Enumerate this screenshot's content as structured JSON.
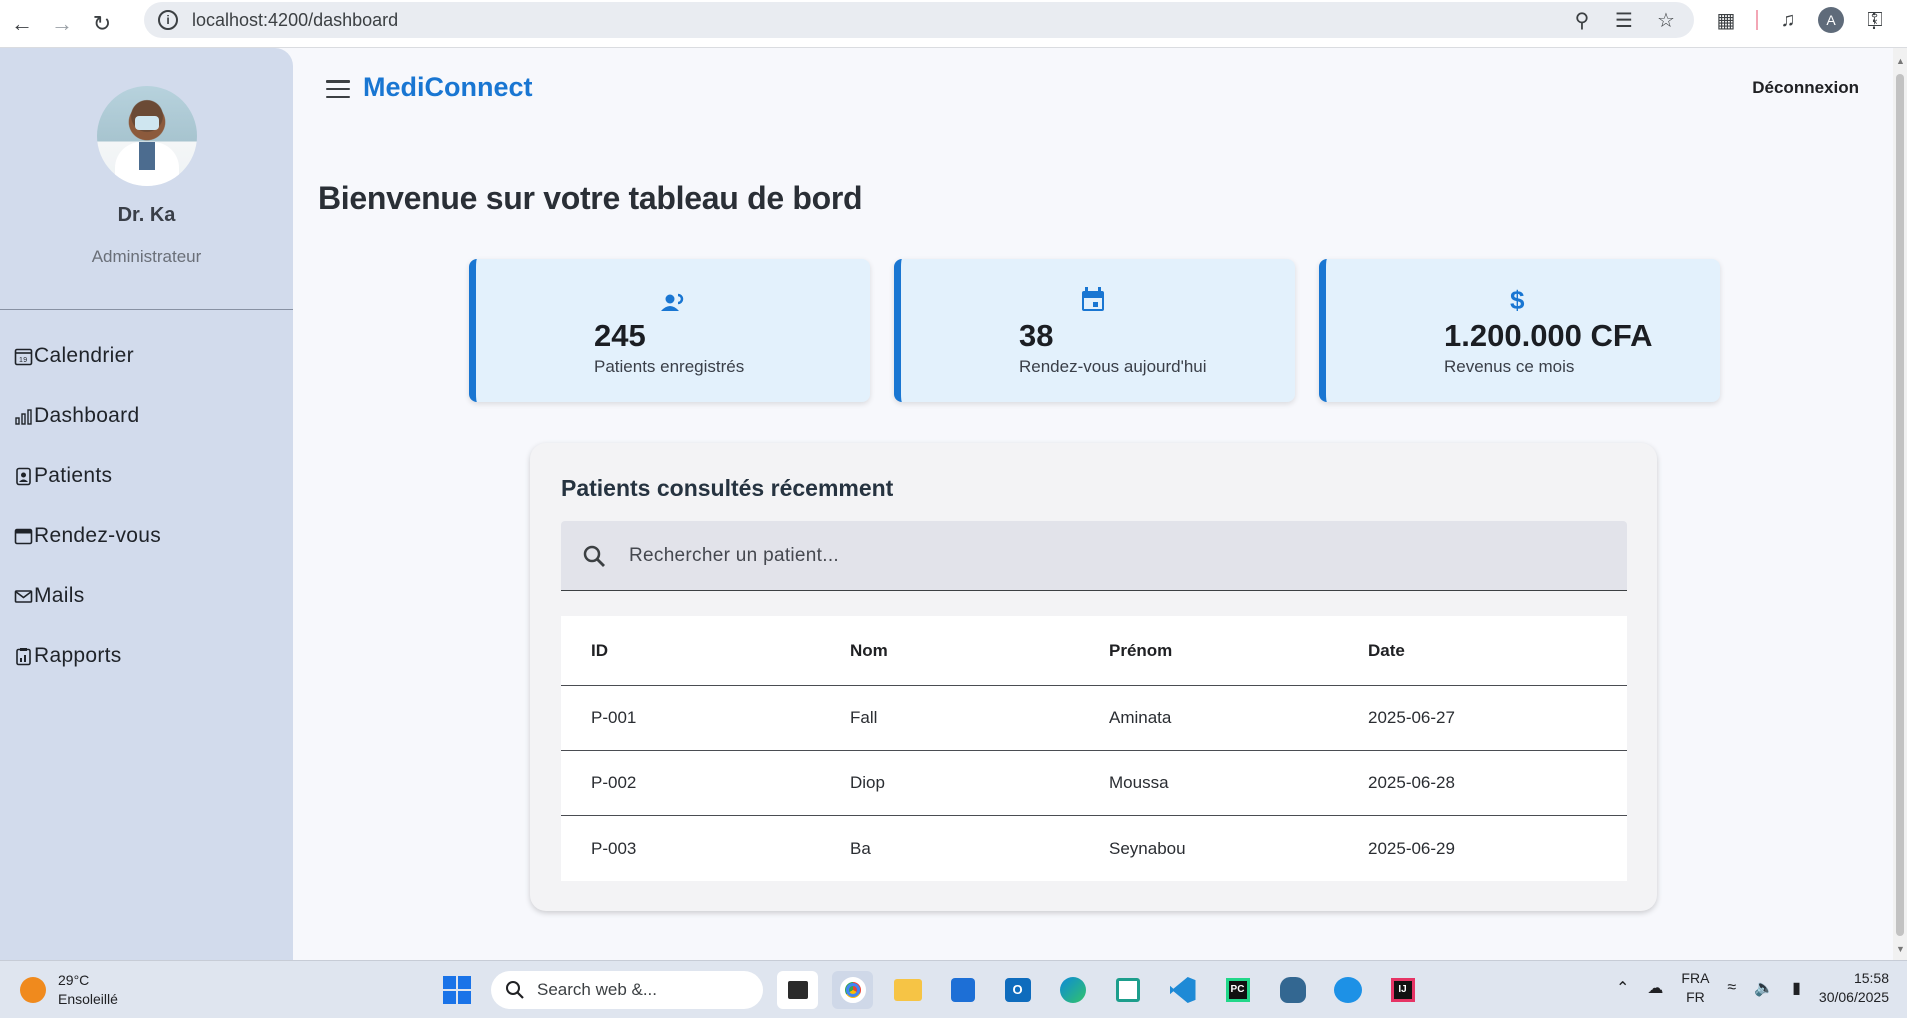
{
  "browser": {
    "url": "localhost:4200/dashboard",
    "profile_initial": "A"
  },
  "sidebar": {
    "user_name": "Dr. Ka",
    "user_role": "Administrateur",
    "items": [
      {
        "label": "Calendrier",
        "icon": "calendar-icon"
      },
      {
        "label": "Dashboard",
        "icon": "bar-chart-icon"
      },
      {
        "label": "Patients",
        "icon": "patient-card-icon"
      },
      {
        "label": "Rendez-vous",
        "icon": "calendar-window-icon"
      },
      {
        "label": "Mails",
        "icon": "mail-icon"
      },
      {
        "label": "Rapports",
        "icon": "report-icon"
      }
    ]
  },
  "header": {
    "brand": "MediConnect",
    "logout_label": "Déconnexion"
  },
  "main": {
    "title": "Bienvenue sur votre tableau de bord",
    "stats": [
      {
        "value": "245",
        "label": "Patients enregistrés",
        "icon": "people-icon"
      },
      {
        "value": "38",
        "label": "Rendez-vous aujourd'hui",
        "icon": "calendar-icon"
      },
      {
        "value": "1.200.000 CFA",
        "label": "Revenus ce mois",
        "icon": "dollar-icon"
      }
    ],
    "recent": {
      "title": "Patients consultés récemment",
      "search_placeholder": "Rechercher un patient...",
      "columns": [
        "ID",
        "Nom",
        "Prénom",
        "Date"
      ],
      "rows": [
        [
          "P-001",
          "Fall",
          "Aminata",
          "2025-06-27"
        ],
        [
          "P-002",
          "Diop",
          "Moussa",
          "2025-06-28"
        ],
        [
          "P-003",
          "Ba",
          "Seynabou",
          "2025-06-29"
        ]
      ]
    }
  },
  "taskbar": {
    "temperature": "29°C",
    "weather": "Ensoleillé",
    "search_text": "Search web &...",
    "lang_top": "FRA",
    "lang_bottom": "FR",
    "time": "15:58",
    "date": "30/06/2025"
  },
  "colors": {
    "accent": "#1976d2",
    "sidebar_bg": "#d2dbec",
    "card_bg": "#e3f1fc"
  }
}
